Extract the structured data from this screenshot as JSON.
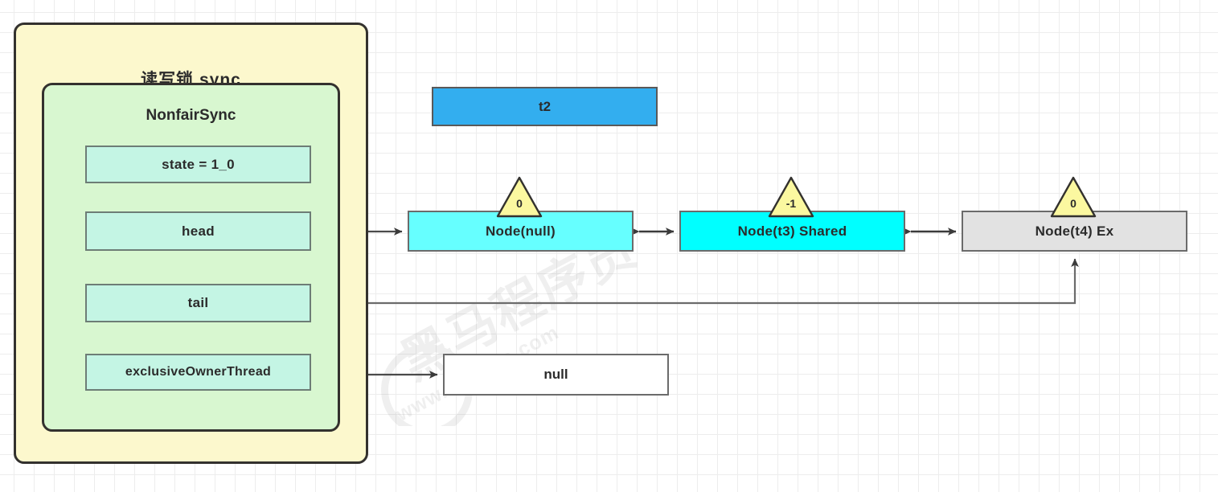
{
  "diagram": {
    "title": "读写锁 sync",
    "inner_title": "NonfairSync",
    "fields": [
      {
        "id": "state",
        "label": "state = 1_0"
      },
      {
        "id": "head",
        "label": "head"
      },
      {
        "id": "tail",
        "label": "tail"
      },
      {
        "id": "exclusiveOwnerThread",
        "label": "exclusiveOwnerThread"
      }
    ],
    "thread_box": {
      "label": "t2",
      "color": "#33aeef"
    },
    "nodes": [
      {
        "id": "node-head",
        "label": "Node(null)",
        "wait_status": "0",
        "color": "#66ffff"
      },
      {
        "id": "node-shared",
        "label": "Node(t3) Shared",
        "wait_status": "-1",
        "color": "#00ffff"
      },
      {
        "id": "node-ex",
        "label": "Node(t4) Ex",
        "wait_status": "0",
        "color": "#e2e2e2"
      }
    ],
    "null_box": {
      "label": "null"
    },
    "watermark": {
      "main": "黑马程序员",
      "sub": "www.itheima.com"
    },
    "colors": {
      "outer_panel": "#fcf8cd",
      "inner_panel": "#d8f7d0",
      "field": "#c4f5e4",
      "triangle": "#fbf8a0",
      "border": "#33312e",
      "connector": "#6b6b6b"
    }
  }
}
